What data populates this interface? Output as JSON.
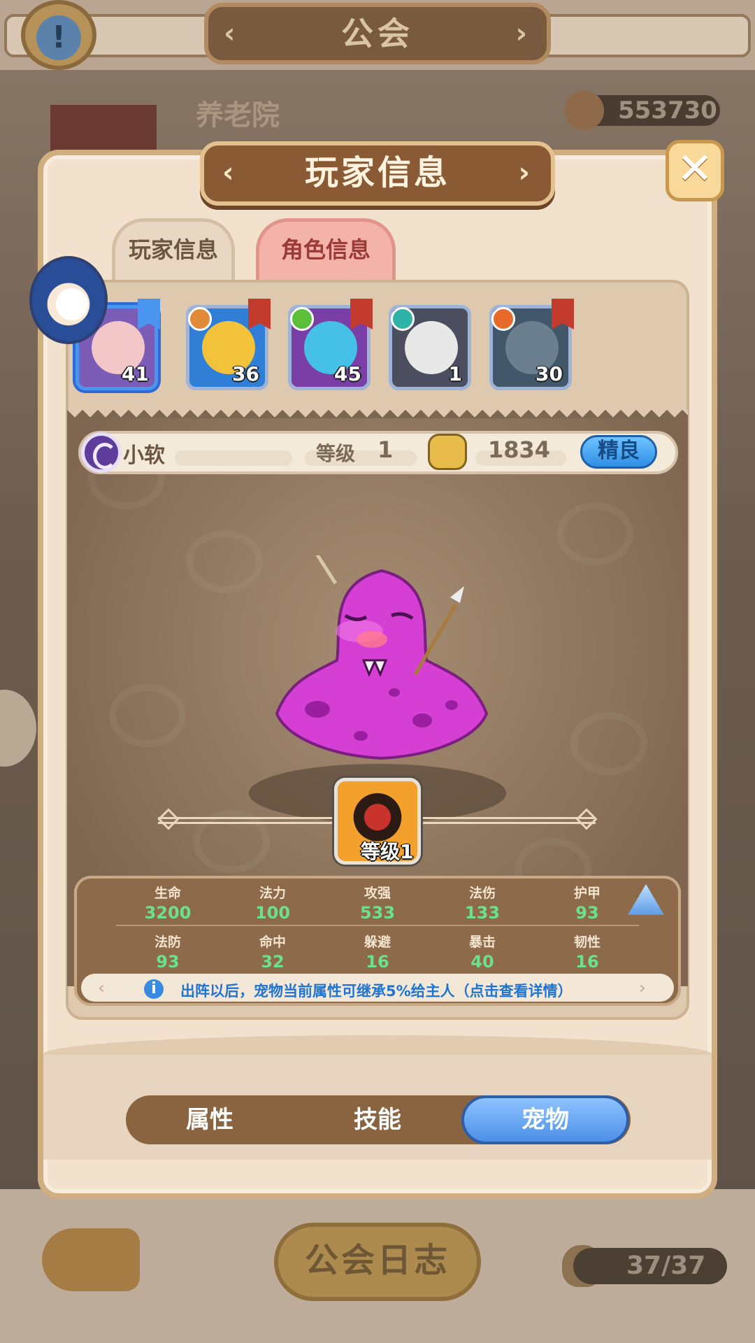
{
  "background": {
    "title": "公会",
    "guild_name": "养老院",
    "guild_score": "553730",
    "log_button": "公会日志",
    "member_count": "37/37"
  },
  "modal": {
    "title": "玩家信息",
    "tabs": [
      {
        "label": "玩家信息",
        "active": false
      },
      {
        "label": "角色信息",
        "active": true
      }
    ],
    "characters": [
      {
        "level": "41",
        "color": "#f3c7c7",
        "selected": true
      },
      {
        "level": "36",
        "color": "#f2c23b",
        "selected": false
      },
      {
        "level": "45",
        "color": "#45c1e8",
        "selected": false
      },
      {
        "level": "1",
        "color": "#e8e8e8",
        "selected": false
      },
      {
        "level": "30",
        "color": "#6c7f8e",
        "selected": false
      }
    ],
    "pet": {
      "name": "小软",
      "level_label": "等级",
      "level": "1",
      "power": "1834",
      "quality": "精良",
      "skill_label": "等级1",
      "color": "#d63fd3"
    },
    "stats": [
      {
        "name": "生命",
        "value": "3200"
      },
      {
        "name": "法力",
        "value": "100"
      },
      {
        "name": "攻强",
        "value": "533"
      },
      {
        "name": "法伤",
        "value": "133"
      },
      {
        "name": "护甲",
        "value": "93"
      },
      {
        "name": "法防",
        "value": "93"
      },
      {
        "name": "命中",
        "value": "32"
      },
      {
        "name": "躲避",
        "value": "16"
      },
      {
        "name": "暴击",
        "value": "40"
      },
      {
        "name": "韧性",
        "value": "16"
      }
    ],
    "tip": "出阵以后，宠物当前属性可继承5%给主人（点击查看详情）",
    "bottom_tabs": [
      {
        "label": "属性",
        "active": false
      },
      {
        "label": "技能",
        "active": false
      },
      {
        "label": "宠物",
        "active": true
      }
    ]
  }
}
